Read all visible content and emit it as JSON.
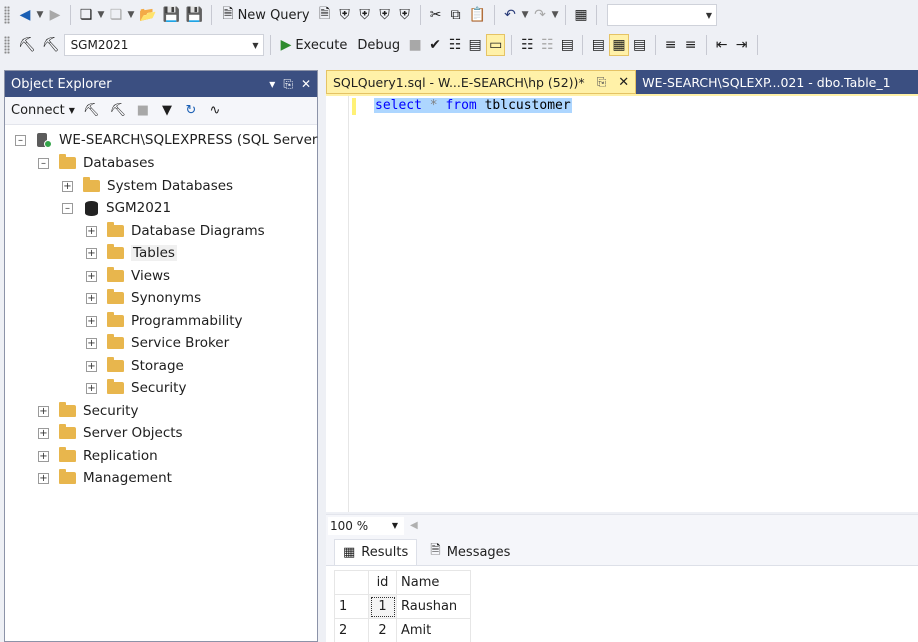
{
  "toolbar1": {
    "new_query_label": "New Query"
  },
  "toolbar2": {
    "database": "SGM2021",
    "execute_label": "Execute",
    "debug_label": "Debug"
  },
  "object_explorer": {
    "title": "Object Explorer",
    "connect_label": "Connect",
    "server": "WE-SEARCH\\SQLEXPRESS (SQL Server",
    "databases": "Databases",
    "system_databases": "System Databases",
    "database_name": "SGM2021",
    "db_children": [
      "Database Diagrams",
      "Tables",
      "Views",
      "Synonyms",
      "Programmability",
      "Service Broker",
      "Storage",
      "Security"
    ],
    "server_children": [
      "Security",
      "Server Objects",
      "Replication",
      "Management"
    ]
  },
  "tabs": {
    "active": "SQLQuery1.sql - W...E-SEARCH\\hp (52))*",
    "inactive": "WE-SEARCH\\SQLEXP...021 - dbo.Table_1"
  },
  "editor": {
    "kw_select": "select",
    "op_star": "*",
    "kw_from": "from",
    "table": "tblcustomer"
  },
  "zoom": "100 %",
  "results": {
    "results_tab": "Results",
    "messages_tab": "Messages",
    "columns": [
      "id",
      "Name"
    ],
    "rows": [
      {
        "num": "1",
        "id": "1",
        "name": "Raushan"
      },
      {
        "num": "2",
        "id": "2",
        "name": "Amit"
      }
    ]
  }
}
